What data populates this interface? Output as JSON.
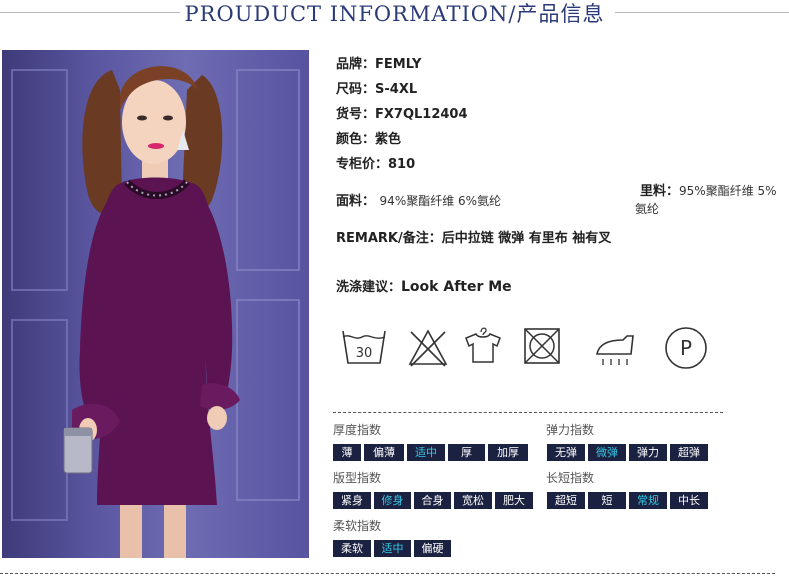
{
  "header": {
    "title": "PROUDUCT INFORMATION/产品信息"
  },
  "product": {
    "brand": {
      "label": "品牌：",
      "value": "FEMLY"
    },
    "size": {
      "label": "尺码：",
      "value": "S-4XL"
    },
    "sku": {
      "label": "货号：",
      "value": "FX7QL12404"
    },
    "color": {
      "label": "颜色：",
      "value": "紫色"
    },
    "price": {
      "label": "专柜价：",
      "value": "810"
    },
    "fabric": {
      "label": "面料：",
      "value": "94%聚酯纤维 6%氨纶"
    },
    "lining": {
      "label": "里料：",
      "value_line1": "95%聚酯纤维 5%",
      "value_line2": "氨纶"
    },
    "remark": {
      "label": "REMARK/备注：",
      "value": "后中拉链 微弹 有里布 袖有叉"
    },
    "wash": {
      "label": "洗涤建议：",
      "value": "Look After Me"
    }
  },
  "care_icons": [
    {
      "name": "wash-30-icon",
      "text": "30"
    },
    {
      "name": "no-bleach-icon"
    },
    {
      "name": "hang-dry-icon"
    },
    {
      "name": "no-tumble-dry-icon"
    },
    {
      "name": "iron-steam-icon"
    },
    {
      "name": "dry-clean-p-icon",
      "text": "P"
    }
  ],
  "indices": {
    "thickness": {
      "title": "厚度指数",
      "options": [
        "薄",
        "偏薄",
        "适中",
        "厚",
        "加厚"
      ],
      "selected": 2
    },
    "elasticity": {
      "title": "弹力指数",
      "options": [
        "无弹",
        "微弹",
        "弹力",
        "超弹"
      ],
      "selected": 1
    },
    "fit": {
      "title": "版型指数",
      "options": [
        "紧身",
        "修身",
        "合身",
        "宽松",
        "肥大"
      ],
      "selected": 1
    },
    "length": {
      "title": "长短指数",
      "options": [
        "超短",
        "短",
        "常规",
        "中长"
      ],
      "selected": 2
    },
    "softness": {
      "title": "柔软指数",
      "options": [
        "柔软",
        "适中",
        "偏硬"
      ],
      "selected": 1
    }
  },
  "colors": {
    "accent": "#35c8e6",
    "chip_bg": "#1b2140",
    "title_color": "#2b3a78",
    "dress": "#5b1352"
  }
}
